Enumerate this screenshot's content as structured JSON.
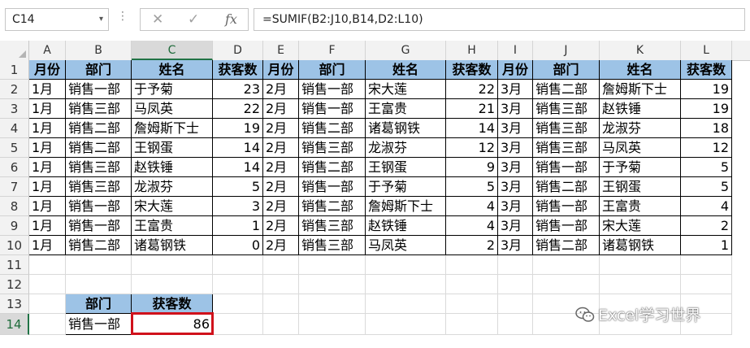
{
  "formula_bar": {
    "name_box": "C14",
    "name_box_arrow": "▾",
    "dots": "⋮",
    "cancel_glyph": "✕",
    "confirm_glyph": "✓",
    "fx_glyph": "fx",
    "formula": "=SUMIF(B2:J10,B14,D2:L10)"
  },
  "columns": [
    "A",
    "B",
    "C",
    "D",
    "E",
    "F",
    "G",
    "H",
    "I",
    "J",
    "K",
    "L"
  ],
  "selected_column": "C",
  "rows": [
    "1",
    "2",
    "3",
    "4",
    "5",
    "6",
    "7",
    "8",
    "9",
    "10",
    "11",
    "12",
    "13",
    "14"
  ],
  "selected_row": "14",
  "header_row": [
    "月份",
    "部门",
    "姓名",
    "获客数",
    "月份",
    "部门",
    "姓名",
    "获客数",
    "月份",
    "部门",
    "姓名",
    "获客数"
  ],
  "data_rows": [
    [
      "1月",
      "销售一部",
      "于予菊",
      "23",
      "2月",
      "销售一部",
      "宋大莲",
      "22",
      "3月",
      "销售二部",
      "詹姆斯下士",
      "19"
    ],
    [
      "1月",
      "销售三部",
      "马凤英",
      "22",
      "2月",
      "销售一部",
      "王富贵",
      "21",
      "3月",
      "销售三部",
      "赵铁锤",
      "19"
    ],
    [
      "1月",
      "销售二部",
      "詹姆斯下士",
      "19",
      "2月",
      "销售二部",
      "诸葛钢铁",
      "14",
      "3月",
      "销售三部",
      "龙淑芬",
      "18"
    ],
    [
      "1月",
      "销售二部",
      "王钢蛋",
      "14",
      "2月",
      "销售三部",
      "龙淑芬",
      "12",
      "3月",
      "销售三部",
      "马凤英",
      "12"
    ],
    [
      "1月",
      "销售三部",
      "赵铁锤",
      "14",
      "2月",
      "销售二部",
      "王钢蛋",
      "9",
      "3月",
      "销售一部",
      "于予菊",
      "5"
    ],
    [
      "1月",
      "销售三部",
      "龙淑芬",
      "5",
      "2月",
      "销售一部",
      "于予菊",
      "5",
      "3月",
      "销售二部",
      "王钢蛋",
      "5"
    ],
    [
      "1月",
      "销售一部",
      "宋大莲",
      "3",
      "2月",
      "销售二部",
      "詹姆斯下士",
      "4",
      "3月",
      "销售一部",
      "王富贵",
      "4"
    ],
    [
      "1月",
      "销售一部",
      "王富贵",
      "1",
      "2月",
      "销售三部",
      "赵铁锤",
      "4",
      "3月",
      "销售一部",
      "宋大莲",
      "2"
    ],
    [
      "1月",
      "销售二部",
      "诸葛钢铁",
      "0",
      "2月",
      "销售三部",
      "马凤英",
      "2",
      "3月",
      "销售二部",
      "诸葛钢铁",
      "1"
    ]
  ],
  "lookup_table": {
    "header": [
      "部门",
      "获客数"
    ],
    "dept": "销售一部",
    "result": "86"
  },
  "watermark": "Excel学习世界",
  "colors": {
    "header_fill": "#9dc3e6",
    "selection_border": "#d0111b",
    "excel_green": "#217346"
  }
}
